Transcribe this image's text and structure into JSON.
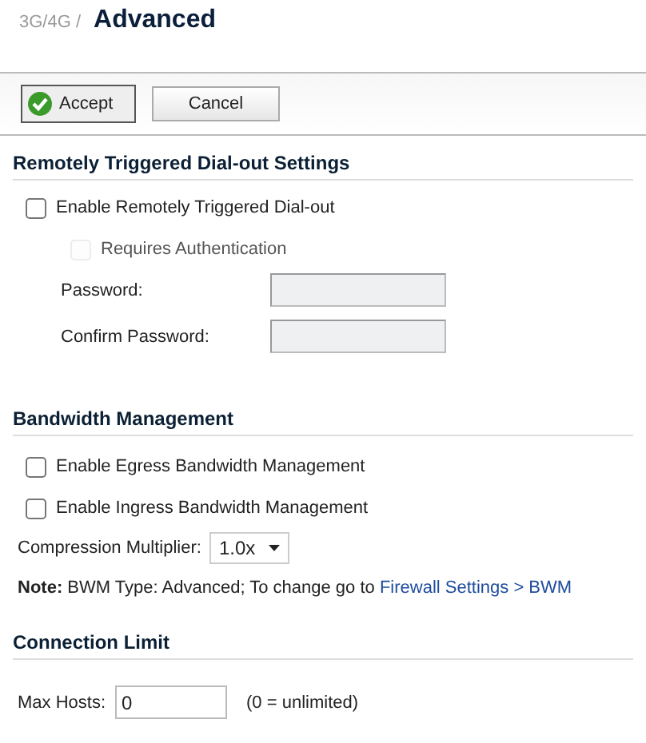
{
  "breadcrumb": "3G/4G /",
  "title": "Advanced",
  "toolbar": [
    {
      "label": "Accept",
      "kind": "accept"
    },
    {
      "label": "Cancel",
      "kind": "plain"
    }
  ],
  "dialout": {
    "heading": "Remotely Triggered Dial-out Settings",
    "enable": {
      "label": "Enable Remotely Triggered Dial-out",
      "checked": false,
      "disabled": false
    },
    "auth": {
      "label": "Requires Authentication",
      "checked": false,
      "disabled": true
    },
    "fields": [
      {
        "label": "Password:",
        "disabled": true
      },
      {
        "label": "Confirm Password:",
        "disabled": true
      }
    ]
  },
  "bandwidth": {
    "heading": "Bandwidth Management",
    "options": [
      {
        "label": "Enable Egress Bandwidth Management",
        "checked": false,
        "disabled": false
      },
      {
        "label": "Enable Ingress Bandwidth Management",
        "checked": false,
        "disabled": false
      }
    ],
    "multiplier": {
      "label": "Compression Multiplier:",
      "value": "1.0x"
    },
    "note": {
      "label": "Note:",
      "text": "BWM Type: Advanced; To change go to",
      "link": "Firewall Settings > BWM"
    }
  },
  "connection": {
    "heading": "Connection Limit",
    "max_hosts": {
      "label": "Max Hosts:",
      "value": "0",
      "hint": "(0 = unlimited)"
    }
  }
}
